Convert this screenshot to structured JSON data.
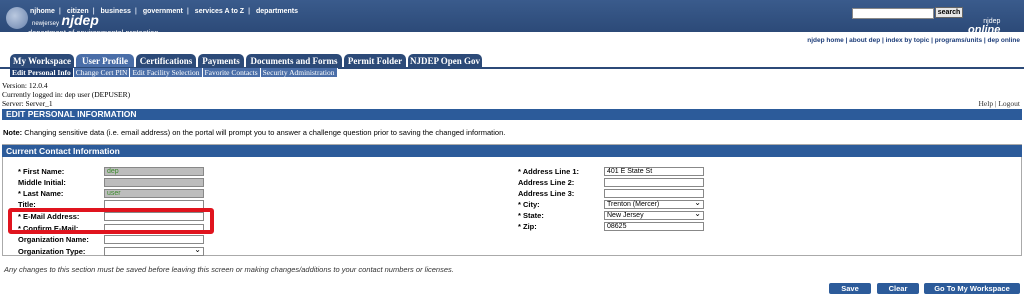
{
  "header": {
    "top_links": [
      "njhome",
      "citizen",
      "business",
      "government",
      "services A to Z",
      "departments"
    ],
    "logo_small": "newjersey",
    "logo_abbr": "njdep",
    "logo_sub": "department of environmental protection",
    "search_button": "search",
    "brand_top": "njdep",
    "brand_main": "online",
    "sub_links": "njdep home  |  about dep  |  index by topic  |  programs/units  |  dep online"
  },
  "tabs": [
    "My Workspace",
    "User Profile",
    "Certifications",
    "Payments",
    "Documents and Forms",
    "Permit Folder",
    "NJDEP Open Gov"
  ],
  "subnav": [
    "Edit Personal Info",
    "Change Cert PIN",
    "Edit Facility Selection",
    "Favorite Contacts",
    "Security Administration"
  ],
  "meta": {
    "version": "Version: 12.0.4",
    "logged_in": "Currently logged in: dep user (DEPUSER)",
    "server": "Server: Server_1",
    "help": "Help | Logout"
  },
  "section_title": "EDIT PERSONAL INFORMATION",
  "note_bold": "Note:",
  "note_text": " Changing sensitive data (i.e. email address) on the portal will prompt you to answer a challenge question prior to saving the changed information.",
  "contact_title": "Current Contact Information",
  "left_fields": {
    "first_name_label": "* First Name:",
    "first_name_value": "dep",
    "middle_label": "Middle Initial:",
    "last_name_label": "* Last Name:",
    "last_name_value": "user",
    "title_label": "Title:",
    "email_label": "* E-Mail Address:",
    "confirm_email_label": "* Confirm E-Mail:",
    "org_name_label": "Organization Name:",
    "org_type_label": "Organization Type:"
  },
  "right_fields": {
    "addr1_label": "* Address Line 1:",
    "addr1_value": "401 E State St",
    "addr2_label": "Address Line 2:",
    "addr3_label": "Address Line 3:",
    "city_label": "* City:",
    "city_value": "Trenton (Mercer)",
    "state_label": "* State:",
    "state_value": "New Jersey",
    "zip_label": "* Zip:",
    "zip_value": "08625"
  },
  "footnote": "Any changes to this section must be saved before leaving this screen or making changes/additions to your contact numbers or licenses.",
  "buttons": {
    "save": "Save",
    "clear": "Clear",
    "workspace": "Go To My Workspace"
  },
  "colors": {
    "header_blue": "#2c4a78",
    "section_blue": "#2c5b9a",
    "highlight_red": "#e0141e"
  }
}
